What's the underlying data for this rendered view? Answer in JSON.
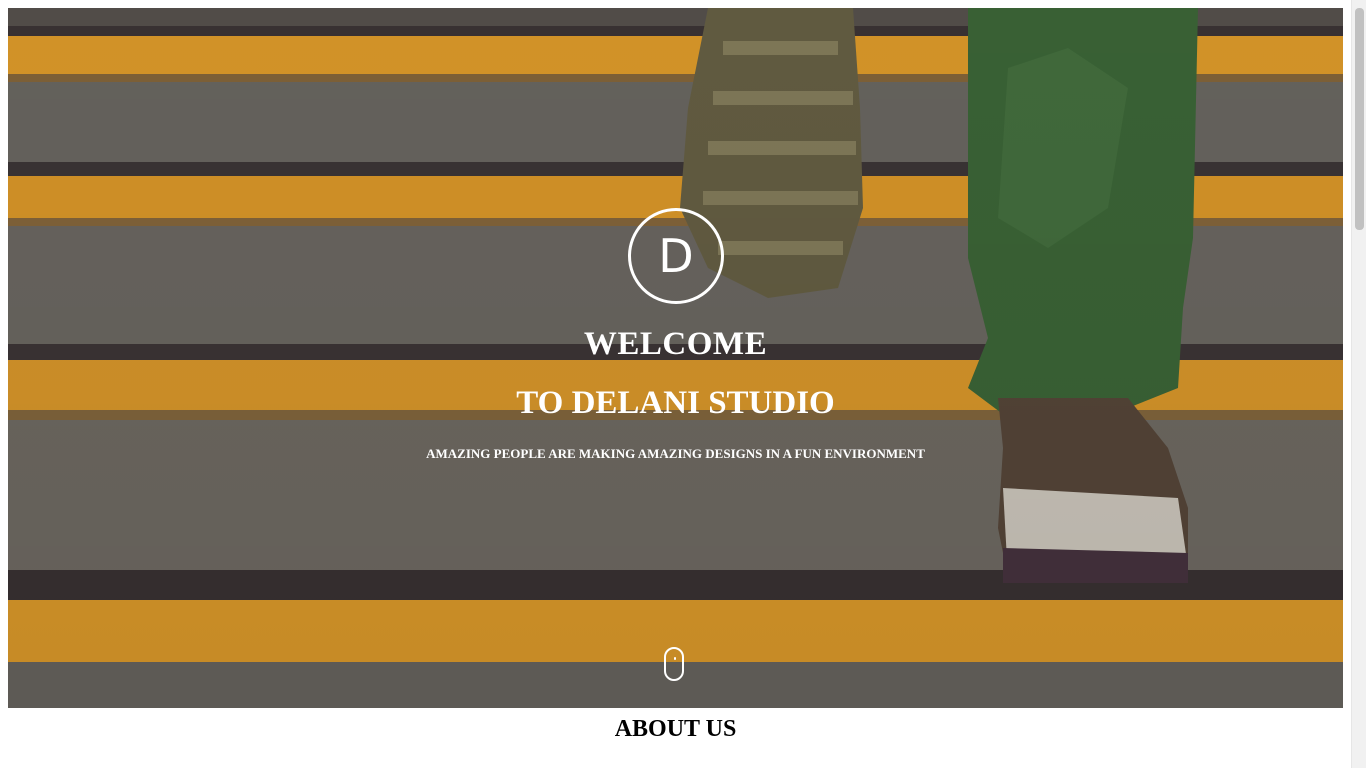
{
  "hero": {
    "logo_letter": "D",
    "title_line1": "WELCOME",
    "title_line2": "TO DELANI STUDIO",
    "tagline": "AMAZING PEOPLE ARE MAKING AMAZING DESIGNS IN A FUN ENVIRONMENT",
    "scroll_icon": "mouse-scroll-icon"
  },
  "about": {
    "title": "ABOUT US",
    "text": ""
  },
  "colors": {
    "stripe_yellow": "#e9a32c",
    "step_gray": "#6d6a64",
    "text_white": "#ffffff"
  }
}
